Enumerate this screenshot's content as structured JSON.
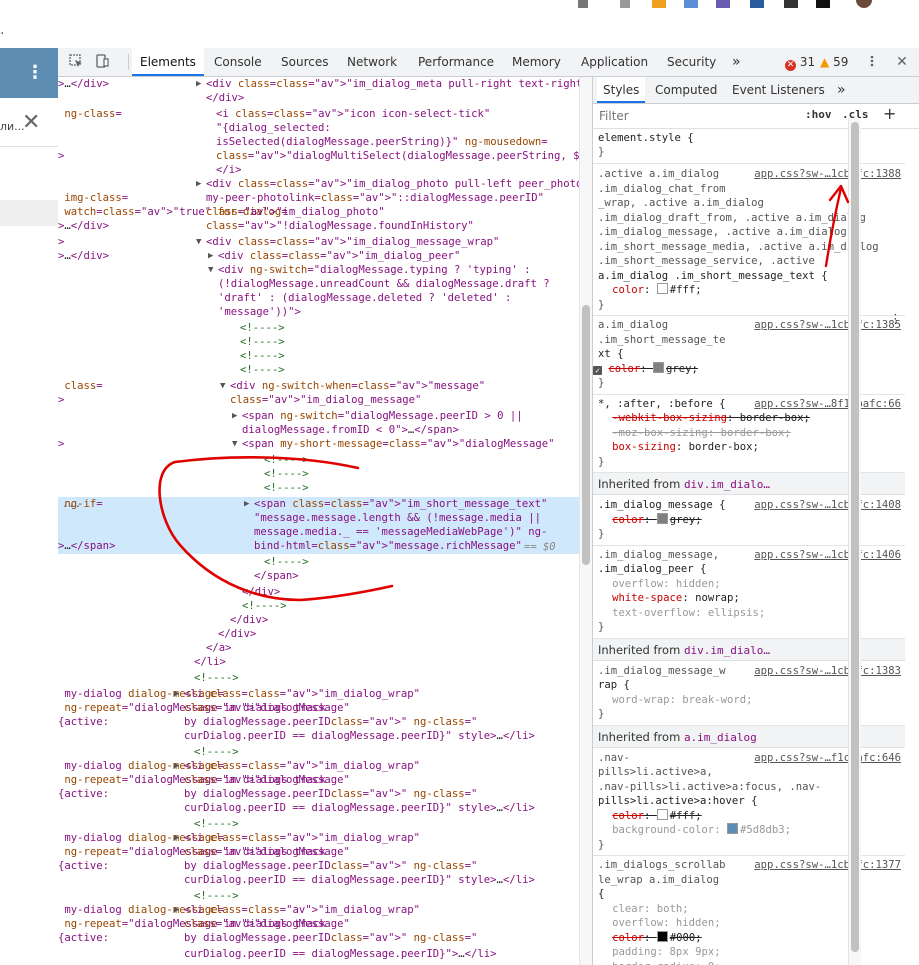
{
  "browser": {
    "address_fragment": "."
  },
  "page": {
    "truncated_text": "ли...",
    "menu_label": "⋮",
    "close_label": "✕"
  },
  "devtools": {
    "tabs": [
      "Elements",
      "Console",
      "Sources",
      "Network",
      "Performance",
      "Memory",
      "Application",
      "Security"
    ],
    "more_tabs": "»",
    "error_count": "31",
    "warning_count": "59",
    "settings_icon": "gear-icon",
    "menu_icon": "kebab-icon",
    "close_label": "✕"
  },
  "elements": {
    "selected_suffix": "== $0",
    "ellipsis": "...",
    "lines": [
      "<div class=\"im_dialog_meta pull-right text-right\">…</div>",
      "</div>",
      "<i class=\"icon icon-select-tick\" ng-class=",
      "\"{dialog_selected:",
      "isSelected(dialogMessage.peerString)}\" ng-mousedown=",
      "\"dialogMultiSelect(dialogMessage.peerString, $event)\">",
      "</i>",
      "<div class=\"im_dialog_photo pull-left peer_photo_init\"",
      "my-peer-photolink=\"::dialogMessage.peerID\" img-class=",
      "\"im_dialog_photo\" watch=\"true\" for-dialog=",
      "\"!dialogMessage.foundInHistory\">…</div>",
      "<div class=\"im_dialog_message_wrap\">",
      "<div class=\"im_dialog_peer\">…</div>",
      "<div ng-switch=\"dialogMessage.typing ? 'typing' :",
      "(!dialogMessage.unreadCount && dialogMessage.draft ?",
      "'draft' : (dialogMessage.deleted ? 'deleted' :",
      "'message'))\">",
      "<!---->",
      "<!---->",
      "<!---->",
      "<!---->",
      "<div ng-switch-when=\"message\" class=",
      "\"im_dialog_message\">",
      "<span ng-switch=\"dialogMessage.peerID > 0 ||",
      "dialogMessage.fromID < 0\">…</span>",
      "<span my-short-message=\"dialogMessage\">",
      "<!---->",
      "<!---->",
      "<!---->",
      "<span class=\"im_short_message_text\" ng-if=",
      "\"message.message.length && (!message.media ||",
      "message.media._ == 'messageMediaWebPage')\" ng-",
      "bind-html=\"message.richMessage\">…</span>",
      "<!---->",
      "</span>",
      "</div>",
      "<!---->",
      "</div>",
      "</div>",
      "</a>",
      "</li>",
      "<!---->",
      "<li class=\"im_dialog_wrap\" my-dialog dialog-message=",
      "\"dialogMessage\" ng-repeat=\"dialogMessage in dialogs track",
      "by dialogMessage.peerID\" ng-class=\"{active:",
      "curDialog.peerID == dialogMessage.peerID}\" style>…</li>",
      "<!---->",
      "<li class=\"im_dialog_wrap\" my-dialog dialog-message=",
      "\"dialogMessage\" ng-repeat=\"dialogMessage in dialogs track",
      "by dialogMessage.peerID\" ng-class=\"{active:",
      "curDialog.peerID == dialogMessage.peerID}\" style>…</li>",
      "<!---->",
      "<li class=\"im_dialog_wrap\" my-dialog dialog-message=",
      "\"dialogMessage\" ng-repeat=\"dialogMessage in dialogs track",
      "by dialogMessage.peerID\" ng-class=\"{active:",
      "curDialog.peerID == dialogMessage.peerID}\" style>…</li>",
      "<!---->",
      "<li class=\"im_dialog_wrap\" my-dialog dialog-message=",
      "\"dialogMessage\" ng-repeat=\"dialogMessage in dialogs track",
      "by dialogMessage.peerID\" ng-class=\"{active:",
      "curDialog.peerID == dialogMessage.peerID}\">…</li>"
    ]
  },
  "styles": {
    "tabs": [
      "Styles",
      "Computed",
      "Event Listeners"
    ],
    "more_tabs": "»",
    "filter_placeholder": "Filter",
    "hov": ":hov",
    "cls": ".cls",
    "add": "+",
    "element_style": "element.style {",
    "close_brace": "}",
    "rules": [
      {
        "selector_lines": [
          ".active a.im_dialog",
          ".im_dialog_chat_from",
          "_wrap, .active a.im_dialog",
          ".im_dialog_draft_from, .active a.im_dialog",
          ".im_dialog_message, .active a.im_dialog",
          ".im_short_message_media, .active a.im_dialog",
          ".im_short_message_service, .active",
          "a.im_dialog .im_short_message_text {"
        ],
        "source": "app.css?sw-…1cbafc:1388",
        "props": [
          {
            "name": "color",
            "value": "#fff",
            "swatch": "#ffffff"
          }
        ]
      },
      {
        "selector_lines": [
          "a.im_dialog",
          ".im_short_message_te",
          "xt {"
        ],
        "source": "app.css?sw-…1cbafc:1385",
        "props": [
          {
            "name": "color",
            "value": "grey",
            "swatch": "#808080"
          }
        ]
      },
      {
        "selector_lines": [
          "*, :after, :before {"
        ],
        "source": "app.css?sw-…8f1cbafc:66",
        "props": [
          {
            "name": "-webkit-box-sizing",
            "value": "border-box"
          },
          {
            "name": "-moz-box-sizing",
            "value": "border-box"
          },
          {
            "name": "box-sizing",
            "value": "border-box"
          }
        ]
      }
    ],
    "inherited": [
      {
        "label": "Inherited from",
        "element": "div.im_dialo…",
        "rules": [
          {
            "selector_lines": [
              ".im_dialog_message {"
            ],
            "source": "app.css?sw-…1cbafc:1408",
            "props": [
              {
                "name": "color",
                "value": "grey",
                "swatch": "#808080"
              }
            ]
          },
          {
            "selector_lines": [
              ".im_dialog_message,",
              ".im_dialog_peer {"
            ],
            "source": "app.css?sw-…1cbafc:1406",
            "props": [
              {
                "name": "overflow",
                "value": "hidden"
              },
              {
                "name": "white-space",
                "value": "nowrap"
              },
              {
                "name": "text-overflow",
                "value": "ellipsis"
              }
            ]
          }
        ]
      },
      {
        "label": "Inherited from",
        "element": "div.im_dialo…",
        "rules": [
          {
            "selector_lines": [
              ".im_dialog_message_w",
              "rap {"
            ],
            "source": "app.css?sw-…1cbafc:1383",
            "props": [
              {
                "name": "word-wrap",
                "value": "break-word"
              }
            ]
          }
        ]
      },
      {
        "label": "Inherited from",
        "element": "a.im_dialog",
        "rules": [
          {
            "selector_lines": [
              ".nav-",
              "pills>li.active>a,",
              ".nav-pills>li.active>a:focus, .nav-",
              "pills>li.active>a:hover {"
            ],
            "source": "app.css?sw-…f1cbafc:646",
            "props": [
              {
                "name": "color",
                "value": "#fff",
                "swatch": "#ffffff"
              },
              {
                "name": "background-color",
                "value": "#5d8db3",
                "swatch": "#5d8db3"
              }
            ]
          },
          {
            "selector_lines": [
              ".im_dialogs_scrollab",
              "le_wrap a.im_dialog",
              "{"
            ],
            "source": "app.css?sw-…1cbafc:1377",
            "props": [
              {
                "name": "clear",
                "value": "both"
              },
              {
                "name": "overflow",
                "value": "hidden"
              },
              {
                "name": "color",
                "value": "#000",
                "swatch": "#000000"
              },
              {
                "name": "padding",
                "value": "8px 9px"
              },
              {
                "name": "border-radius",
                "value": "0"
              }
            ]
          }
        ]
      }
    ]
  },
  "colors": {
    "accent": "#1a73e8",
    "telegram_blue": "#5d8db3",
    "annotation_red": "#e00000"
  }
}
